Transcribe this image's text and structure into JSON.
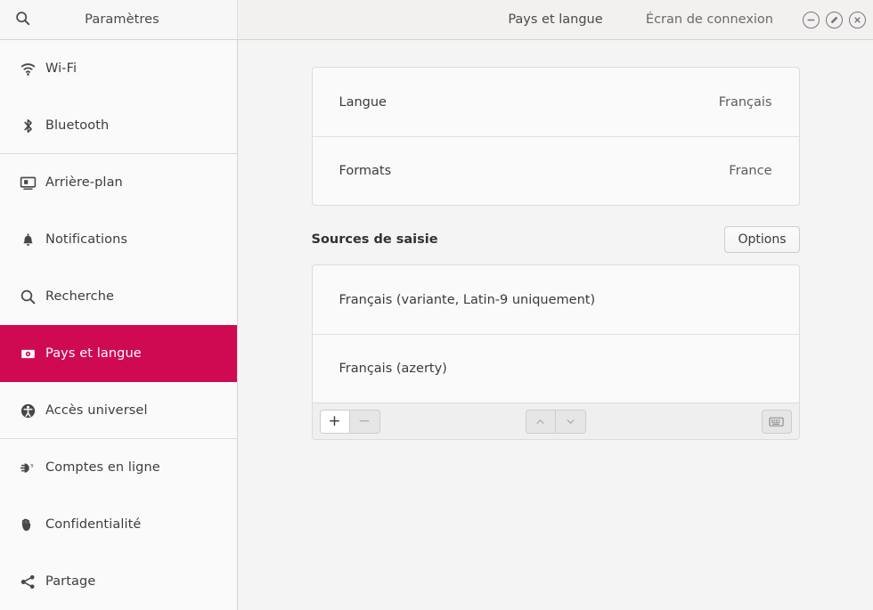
{
  "window": {
    "left_title": "Paramètres",
    "main_title": "Pays et langue",
    "subtitle": "Écran de connexion",
    "search_icon": "search-icon",
    "controls": [
      {
        "name": "minimize-button",
        "icon": "minimize-icon"
      },
      {
        "name": "maximize-button",
        "icon": "restore-icon"
      },
      {
        "name": "close-button",
        "icon": "close-icon"
      }
    ]
  },
  "sidebar": {
    "items": [
      {
        "label": "Wi-Fi",
        "icon": "wifi-icon",
        "selected": false,
        "separator_after": false
      },
      {
        "label": "Bluetooth",
        "icon": "bluetooth-icon",
        "selected": false,
        "separator_after": true
      },
      {
        "label": "Arrière-plan",
        "icon": "background-icon",
        "selected": false,
        "separator_after": false
      },
      {
        "label": "Notifications",
        "icon": "bell-icon",
        "selected": false,
        "separator_after": false
      },
      {
        "label": "Recherche",
        "icon": "search-icon",
        "selected": false,
        "separator_after": false
      },
      {
        "label": "Pays et langue",
        "icon": "flag-globe-icon",
        "selected": true,
        "separator_after": false
      },
      {
        "label": "Accès universel",
        "icon": "accessibility-icon",
        "selected": false,
        "separator_after": true
      },
      {
        "label": "Comptes en ligne",
        "icon": "online-accounts-icon",
        "selected": false,
        "separator_after": false
      },
      {
        "label": "Confidentialité",
        "icon": "hand-privacy-icon",
        "selected": false,
        "separator_after": false
      },
      {
        "label": "Partage",
        "icon": "share-icon",
        "selected": false,
        "separator_after": false
      }
    ]
  },
  "main": {
    "settings_rows": [
      {
        "key": "Langue",
        "value": "Français"
      },
      {
        "key": "Formats",
        "value": "France"
      }
    ],
    "input_sources": {
      "title": "Sources de saisie",
      "options_label": "Options",
      "items": [
        "Français (variante, Latin-9 uniquement)",
        "Français (azerty)"
      ],
      "toolbar": {
        "add_label": "+",
        "remove_label": "−",
        "move_up_icon": "chevron-up-icon",
        "move_down_icon": "chevron-down-icon",
        "preview_icon": "keyboard-icon"
      }
    }
  },
  "colors": {
    "accent": "#cf0a53",
    "sidebar_bg": "#fafafa",
    "main_bg": "#f4f4f4",
    "header_bg": "#f2f1f0",
    "card_bg": "#fafafa",
    "border": "#dcdcdc",
    "text": "#3b3b3b"
  }
}
